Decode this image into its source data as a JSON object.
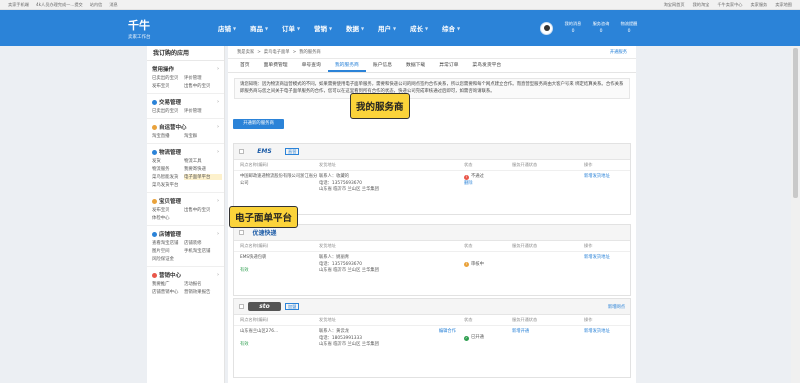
{
  "topbar": {
    "left": [
      "卖家手机端",
      "4k人员办理完成一...提交",
      "站内信",
      "消息"
    ],
    "right": [
      "淘宝网首页",
      "我的淘宝",
      "千牛卖家中心",
      "卖家服务",
      "卖家地图"
    ]
  },
  "nav": {
    "logo": "千牛",
    "sub": "卖家工作台",
    "items": [
      "店铺",
      "商品",
      "订单",
      "营销",
      "数据",
      "用户",
      "成长",
      "综合"
    ],
    "stats": [
      {
        "l": "我的消息",
        "v": "0"
      },
      {
        "l": "服务咨询",
        "v": "0"
      },
      {
        "l": "物流提醒",
        "v": "0"
      }
    ]
  },
  "sidebar": {
    "title": "我订购的应用",
    "sections": [
      {
        "h": "常用操作",
        "items": [
          "已卖出的宝贝",
          "评价管理",
          "发布宝贝",
          "出售中的宝贝"
        ]
      },
      {
        "h": "交易管理",
        "items": [
          "已卖出的宝贝",
          "评价管理"
        ],
        "icon": "#2b83d8"
      },
      {
        "h": "自运营中心",
        "items": [
          "淘宝直播",
          "淘宝群"
        ],
        "icon": "#e9a23b"
      },
      {
        "h": "物流管理",
        "items": [
          "发货",
          "物流工具",
          "物流服务",
          "我要寄快递",
          "菜鸟智能发货",
          "电子面单平台",
          "菜鸟发货平台",
          ""
        ],
        "icon": "#2b83d8"
      },
      {
        "h": "宝贝管理",
        "items": [
          "发布宝贝",
          "出售中的宝贝",
          "体检中心",
          ""
        ],
        "icon": "#e9a23b"
      },
      {
        "h": "店铺管理",
        "items": [
          "查看淘宝店铺",
          "店铺装修",
          "图片空间",
          "手机淘宝店铺",
          "风险保证金",
          ""
        ],
        "icon": "#2b83d8"
      },
      {
        "h": "营销中心",
        "items": [
          "我要推广",
          "活动报名",
          "店铺营销中心",
          "营销效果报告"
        ],
        "icon": "#e9574a"
      }
    ]
  },
  "breadcrumb": [
    "我是卖家",
    ">",
    "菜鸟电子面单",
    ">",
    "我的服务商"
  ],
  "breadcrumb_right": "开通服务",
  "tabs": [
    "首页",
    "面单费管理",
    "单号查询",
    "我的服务商",
    "账户信息",
    "数据下载",
    "异常订单",
    "菜鸟发货平台"
  ],
  "notice": "请您知晓：因为物流商运营模式的不同，如果需要使用电子面单服务，需要和快递公司的网点签约合作关系，所以您需要和每个网点建立合作。而直营型服务商由大客户号来 绑定结算关系。合作关系即服务商与您之间关于电子面单服务的合作，您可以在这里看到所有合作的状态，快递公司完成审核通过后即可，如需咨询请联系。",
  "open_button": "开通新的服务商",
  "columns": [
    "网点名称(编码)",
    "发货地址",
    "状态",
    "服务开通状态",
    "操作"
  ],
  "cards": [
    {
      "brand": "EMS",
      "tag": "直营",
      "more": "",
      "row": {
        "name": "中国邮政速递物流股份有限公司浙江省分公司",
        "addr": "联系人：收藏的\n电话：13575693670\n山东省 临沂市 兰山区 兰华集团",
        "status": "不通过",
        "status_sub": "删除",
        "svc": "",
        "op": "新增发货地址"
      }
    },
    {
      "brand": "优速快递",
      "tag": "",
      "more": "",
      "row": {
        "name": "EMS快递包裹",
        "addr": "联系人：姚丽青\n电话：13575693670\n山东省 临沂市 兰山区 兰华集团",
        "status": "审核中",
        "status_sub": "",
        "svc": "",
        "op": "新增发货地址",
        "tag2": "有效"
      }
    },
    {
      "brand": "sto",
      "tag": "加盟",
      "more": "新增网点",
      "row": {
        "name": "山东省兰山区276...",
        "addr": "联系人：黄云龙\n电话：18053991333\n山东省 临沂市 兰山区 兰华集团",
        "status": "已开通",
        "status_sub": "",
        "svc": "新增开通",
        "op": "新增发货地址",
        "tag2": "有效",
        "edit": "编辑合作"
      }
    }
  ],
  "callouts": {
    "a": "我的服务商",
    "b": "电子面单平台"
  }
}
